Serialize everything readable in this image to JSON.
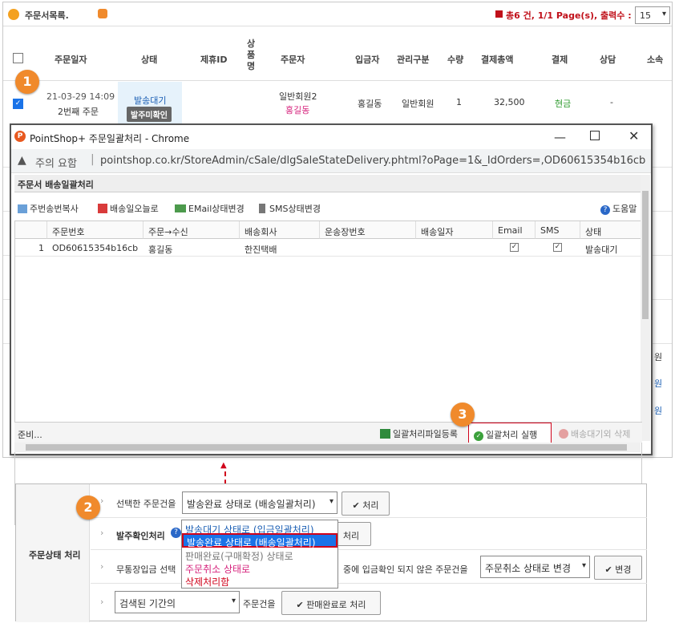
{
  "list": {
    "title": "주문서목록.",
    "summary": "총6 건, 1/1 Page(s), 출력수 :",
    "per_page": "15",
    "columns": [
      "주문일자",
      "상태",
      "제휴ID",
      "상\n품\n명",
      "주문자",
      "입금자",
      "관리구분",
      "수량",
      "결제총액",
      "결제",
      "상담",
      "소속"
    ],
    "row": {
      "date": "21-03-29 14:09",
      "order_seq": "2번째 주문",
      "status": "발송대기",
      "status_badge": "발주미확인",
      "member": "일반회원2",
      "orderer": "홍길동",
      "depositor": "홍길동",
      "manage": "일반회원",
      "qty": "1",
      "total": "32,500",
      "payment": "현금",
      "consult": "-"
    },
    "side_tail": [
      "원",
      "원",
      "원"
    ]
  },
  "popup": {
    "window_title": "PointShop+ 주문일괄처리 - Chrome",
    "security_label": "주의 요함",
    "url": "pointshop.co.kr/StoreAdmin/cSale/dlgSaleStateDelivery.phtml?oPage=1&_IdOrders=,OD60615354b16cb",
    "section_title": "주문서 배송일괄처리",
    "toolbar": {
      "copy": "주번송번복사",
      "delivery_date": "배송일오늘로",
      "email": "EMail상태변경",
      "sms": "SMS상태변경",
      "help": "도움말"
    },
    "grid": {
      "headers": [
        "주문번호",
        "주문→수신",
        "배송회사",
        "운송장번호",
        "배송일자",
        "Email",
        "SMS",
        "상태"
      ],
      "row": {
        "num": "1",
        "order_no": "OD60615354b16cb",
        "receiver": "홍길동",
        "company": "한진택배",
        "status": "발송대기"
      }
    },
    "statusbar": {
      "ready": "준비...",
      "file_register": "일괄처리파일등록",
      "execute": "일괄처리 실행",
      "delete": "배송대기외 삭제"
    }
  },
  "bottom": {
    "label": "주문상태 처리",
    "row1_label": "선택한 주문건을",
    "row1_select": "발송완료 상태로 (배송일괄처리)",
    "row1_btn": "처리",
    "row2_label": "발주확인처리",
    "row2_btn": "처리",
    "dropdown_options": [
      "발송대기 상태로 (입금일괄처리)",
      "발송완료 상태로 (배송일괄처리)",
      "판매완료(구매확정) 상태로",
      "주문취소 상태로",
      "삭제처리함"
    ],
    "row3_label": "무통장입금 선택",
    "row3_mid": "중에 입금확인 되지 않은 주문건을",
    "row3_select": "주문취소 상태로 변경",
    "row3_btn": "변경",
    "row4_select": "검색된 기간의",
    "row4_label": "주문건을",
    "row4_btn": "판매완료로 처리"
  },
  "steps": [
    "1",
    "2",
    "3"
  ],
  "colors": {
    "accent_orange": "#f08a2c",
    "highlight_red": "#d0021b",
    "select_blue": "#1a73e8",
    "link_blue": "#1b5fb4",
    "pink": "#d6247d",
    "green": "#2e9a2e"
  }
}
